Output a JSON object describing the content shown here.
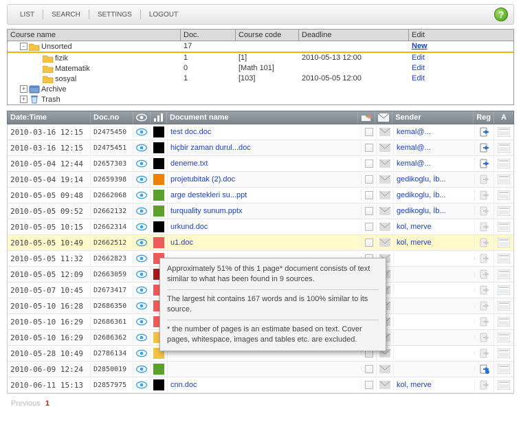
{
  "toolbar": {
    "items": [
      "LIST",
      "SEARCH",
      "SETTINGS",
      "LOGOUT"
    ]
  },
  "tree": {
    "headers": {
      "name": "Course name",
      "doc": "Doc.",
      "code": "Course code",
      "deadline": "Deadline",
      "edit": "Edit"
    },
    "nodes": [
      {
        "indent": 1,
        "name": "Unsorted",
        "doc": "17",
        "code": "",
        "deadline": "",
        "edit": "New",
        "editClass": "newlink",
        "expander": "-",
        "kind": "folder"
      },
      {
        "indent": 2,
        "name": "fizik",
        "doc": "1",
        "code": "[1]",
        "deadline": "2010-05-13 12:00",
        "edit": "Edit",
        "expander": "",
        "kind": "folder"
      },
      {
        "indent": 2,
        "name": "Matematik",
        "doc": "0",
        "code": "[Math 101]",
        "deadline": "",
        "edit": "Edit",
        "expander": "",
        "kind": "folder"
      },
      {
        "indent": 2,
        "name": "sosyal",
        "doc": "1",
        "code": "[103]",
        "deadline": "2010-05-05 12:00",
        "edit": "Edit",
        "expander": "",
        "kind": "folder"
      },
      {
        "indent": 1,
        "name": "Archive",
        "doc": "",
        "code": "",
        "deadline": "",
        "edit": "",
        "expander": "+",
        "kind": "archive"
      },
      {
        "indent": 1,
        "name": "Trash",
        "doc": "",
        "code": "",
        "deadline": "",
        "edit": "",
        "expander": "+",
        "kind": "trash"
      }
    ]
  },
  "docHeader": {
    "date": "Date:Time",
    "docno": "Doc.no",
    "name": "Document name",
    "sender": "Sender",
    "reg": "Reg",
    "a": "A"
  },
  "rows": [
    {
      "date": "2010-03-16 12:15",
      "docno": "D2475450",
      "color": "#000000",
      "name": "test doc.doc",
      "sender": "kemal@...",
      "reg": "active",
      "highlight": false
    },
    {
      "date": "2010-03-16 12:15",
      "docno": "D2475451",
      "color": "#000000",
      "name": "hiçbir zaman durul...doc",
      "sender": "kemal@...",
      "reg": "active",
      "highlight": false
    },
    {
      "date": "2010-05-04 12:44",
      "docno": "D2657303",
      "color": "#000000",
      "name": "deneme.txt",
      "sender": "kemal@...",
      "reg": "active",
      "highlight": false
    },
    {
      "date": "2010-05-04 19:14",
      "docno": "D2659398",
      "color": "#f08000",
      "name": "projetubitak (2).doc",
      "sender": "gedikoglu, İb...",
      "reg": "inactive",
      "highlight": false
    },
    {
      "date": "2010-05-05 09:48",
      "docno": "D2662068",
      "color": "#5aa02c",
      "name": "arge destekleri su...ppt",
      "sender": "gedikoglu, İb...",
      "reg": "inactive",
      "highlight": false
    },
    {
      "date": "2010-05-05 09:52",
      "docno": "D2662132",
      "color": "#5aa02c",
      "name": "turquality sunum.pptx",
      "sender": "gedikoglu, İb...",
      "reg": "inactive",
      "highlight": false
    },
    {
      "date": "2010-05-05 10:15",
      "docno": "D2662314",
      "color": "#000000",
      "name": "urkund.doc",
      "sender": "kol, merve",
      "reg": "inactive",
      "highlight": false
    },
    {
      "date": "2010-05-05 10:49",
      "docno": "D2662512",
      "color": "#ef5b5b",
      "name": "u1.doc",
      "sender": "kol, merve",
      "reg": "inactive",
      "highlight": true
    },
    {
      "date": "2010-05-05 11:32",
      "docno": "D2662823",
      "color": "#ef5b5b",
      "name": "",
      "sender": "",
      "reg": "inactive",
      "highlight": false
    },
    {
      "date": "2010-05-05 12:09",
      "docno": "D2663059",
      "color": "#a81818",
      "name": "",
      "sender": "",
      "reg": "inactive",
      "highlight": false
    },
    {
      "date": "2010-05-07 10:45",
      "docno": "D2673417",
      "color": "#ef5b5b",
      "name": "",
      "sender": "",
      "reg": "inactive",
      "highlight": false
    },
    {
      "date": "2010-05-10 16:28",
      "docno": "D2686350",
      "color": "#ef5b5b",
      "name": "",
      "sender": "",
      "reg": "inactive",
      "highlight": false
    },
    {
      "date": "2010-05-10 16:29",
      "docno": "D2686361",
      "color": "#ef5b5b",
      "name": "",
      "sender": "",
      "reg": "inactive",
      "highlight": false
    },
    {
      "date": "2010-05-10 16:29",
      "docno": "D2686362",
      "color": "#f5c242",
      "name": "",
      "sender": "",
      "reg": "inactive",
      "highlight": false
    },
    {
      "date": "2010-05-28 10:49",
      "docno": "D2786134",
      "color": "#f5c242",
      "name": "",
      "sender": "",
      "reg": "inactive",
      "highlight": false
    },
    {
      "date": "2010-06-09 12:24",
      "docno": "D2850019",
      "color": "#5aa02c",
      "name": "",
      "sender": "",
      "reg": "active2",
      "highlight": false
    },
    {
      "date": "2010-06-11 15:13",
      "docno": "D2857975",
      "color": "#000000",
      "name": "cnn.doc",
      "sender": "kol, merve",
      "reg": "inactive",
      "highlight": false
    }
  ],
  "tooltip": {
    "p1": "Approximately 51% of this 1 page* document consists of text similar to what has been found in  9 sources.",
    "p2": "The largest hit contains 167 words and is 100% similar to its source.",
    "p3": "* the number of pages is an estimate based on text. Cover pages, whitespace, images and tables etc. are excluded."
  },
  "pager": {
    "prev": "Previous",
    "current": "1"
  }
}
